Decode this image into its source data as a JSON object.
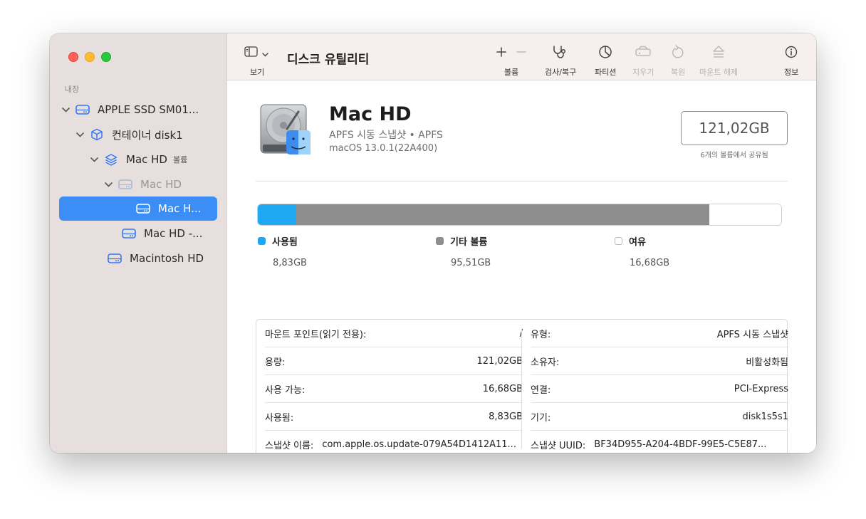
{
  "app": {
    "title": "디스크 유틸리티"
  },
  "toolbar": {
    "view_label": "보기",
    "volume_label": "볼륨",
    "first_aid_label": "검사/복구",
    "partition_label": "파티션",
    "erase_label": "지우기",
    "restore_label": "복원",
    "unmount_label": "마운트 해제",
    "info_label": "정보"
  },
  "sidebar": {
    "section": "내장",
    "items": [
      {
        "label": "APPLE SSD SM01...",
        "icon": "internal-drive-icon"
      },
      {
        "label": "컨테이너 disk1",
        "icon": "container-cube-icon"
      },
      {
        "label": "Mac HD",
        "tag": "볼륨",
        "icon": "volume-layers-icon"
      },
      {
        "label": "Mac HD",
        "icon": "disk-icon"
      },
      {
        "label": "Mac H...",
        "icon": "disk-icon"
      },
      {
        "label": "Mac HD -...",
        "icon": "disk-icon"
      },
      {
        "label": "Macintosh HD",
        "icon": "disk-icon"
      }
    ]
  },
  "volume": {
    "name": "Mac HD",
    "subtitle": "APFS 시동 스냅샷 • APFS",
    "os": "macOS 13.0.1(22A400)",
    "capacity": "121,02GB",
    "capacity_note": "6개의 볼륨에서 공유됨"
  },
  "usage": {
    "segments": [
      {
        "label": "사용됨",
        "value": "8,83GB",
        "gb": 8.83,
        "color": "#1fa7f2"
      },
      {
        "label": "기타 볼륨",
        "value": "95,51GB",
        "gb": 95.51,
        "color": "#8e8e8e"
      },
      {
        "label": "여유",
        "value": "16,68GB",
        "gb": 16.68,
        "color": "#ffffff"
      }
    ]
  },
  "info": {
    "left": [
      {
        "key": "마운트 포인트(읽기 전용):",
        "value": "/"
      },
      {
        "key": "용량:",
        "value": "121,02GB"
      },
      {
        "key": "사용 가능:",
        "value": "16,68GB"
      },
      {
        "key": "사용됨:",
        "value": "8,83GB"
      },
      {
        "key": "스냅샷 이름:",
        "value": "com.apple.os.update-079A54D1412A11..."
      }
    ],
    "right": [
      {
        "key": "유형:",
        "value": "APFS 시동 스냅샷"
      },
      {
        "key": "소유자:",
        "value": "비활성화됨"
      },
      {
        "key": "연결:",
        "value": "PCI-Express"
      },
      {
        "key": "기기:",
        "value": "disk1s5s1"
      },
      {
        "key": "스냅샷 UUID:",
        "value": "BF34D955-A204-4BDF-99E5-C5E87..."
      }
    ]
  }
}
